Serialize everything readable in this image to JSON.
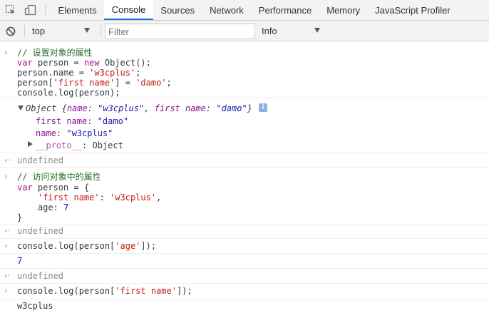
{
  "tabs": [
    {
      "label": "Elements"
    },
    {
      "label": "Console",
      "active": true
    },
    {
      "label": "Sources"
    },
    {
      "label": "Network"
    },
    {
      "label": "Performance"
    },
    {
      "label": "Memory"
    },
    {
      "label": "JavaScript Profiler"
    }
  ],
  "toolbar": {
    "context": "top",
    "filter_placeholder": "Filter",
    "level": "Info",
    "accent": "#1a73e8"
  },
  "entry1": {
    "comment": "// 设置对象的属性",
    "l2_kw": "var",
    "l2_a": " person = ",
    "l2_kw2": "new",
    "l2_b": " Object();",
    "l3_a": "person.name = ",
    "l3_str": "'w3cplus'",
    "l3_b": ";",
    "l4_a": "person[",
    "l4_str": "'first name'",
    "l4_b": "] = ",
    "l4_str2": "'damo'",
    "l4_c": ";",
    "l5": "console.log(person);"
  },
  "log1": {
    "object_type": "Object",
    "preview_open": " {",
    "k1": "name",
    "colon1": ": ",
    "v1": "\"w3cplus\"",
    "comma": ", ",
    "k2": "first name",
    "colon2": ": ",
    "v2": "\"damo\"",
    "preview_close": "}",
    "info_label": "i",
    "p1_key": "first name",
    "p1_colon": ": ",
    "p1_val": "\"damo\"",
    "p2_key": "name",
    "p2_colon": ": ",
    "p2_val": "\"w3cplus\"",
    "proto_key": "__proto__",
    "proto_val": ": Object"
  },
  "result1": "undefined",
  "entry2": {
    "comment": "// 访问对象中的属性",
    "l2_kw": "var",
    "l2_a": " person = {",
    "l3_pad": "    ",
    "l3_str": "'first name'",
    "l3_a": ": ",
    "l3_str2": "'w3cplus'",
    "l3_b": ",",
    "l4_a": "    age: ",
    "l4_num": "7",
    "l5": "}"
  },
  "result2": "undefined",
  "entry3": {
    "a": "console.log(person[",
    "str": "'age'",
    "b": "]);"
  },
  "log3": "7",
  "result3": "undefined",
  "entry4": {
    "a": "console.log(person[",
    "str": "'first name'",
    "b": "]);"
  },
  "log4": "w3cplus"
}
